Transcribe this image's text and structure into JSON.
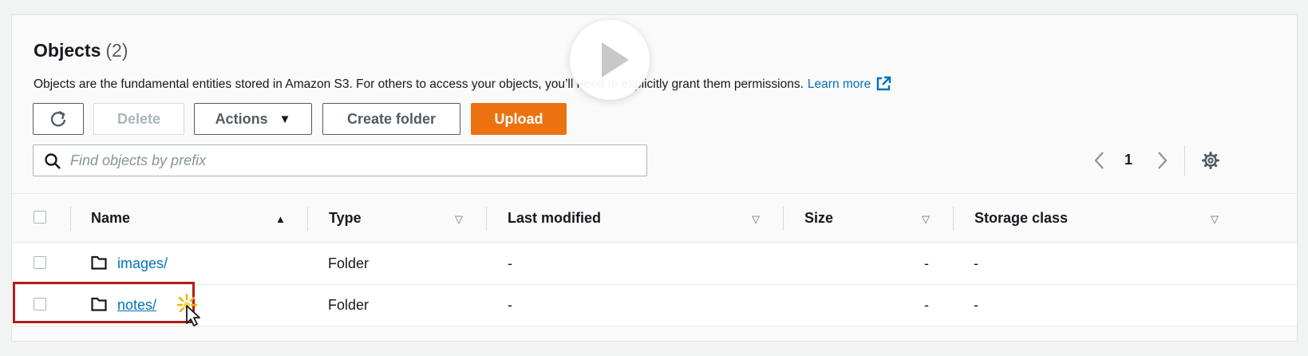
{
  "header": {
    "title": "Objects",
    "count": "(2)",
    "description": "Objects are the fundamental entities stored in Amazon S3. For others to access your objects, you’ll need to explicitly grant them permissions.",
    "learn_more": "Learn more"
  },
  "toolbar": {
    "delete_label": "Delete",
    "actions_label": "Actions",
    "create_folder_label": "Create folder",
    "upload_label": "Upload"
  },
  "search": {
    "placeholder": "Find objects by prefix",
    "value": ""
  },
  "pagination": {
    "current_page": "1"
  },
  "table": {
    "columns": [
      "Name",
      "Type",
      "Last modified",
      "Size",
      "Storage class"
    ],
    "rows": [
      {
        "name": "images/",
        "type": "Folder",
        "last_modified": "-",
        "size": "-",
        "storage_class": "-"
      },
      {
        "name": "notes/",
        "type": "Folder",
        "last_modified": "-",
        "size": "-",
        "storage_class": "-"
      }
    ]
  },
  "colors": {
    "upload_button": "#ec7211",
    "link": "#0073bb",
    "highlight_box": "#b31b1b"
  },
  "icons": [
    "refresh-icon",
    "caret-down-icon",
    "search-icon",
    "chevron-left-icon",
    "chevron-right-icon",
    "gear-icon",
    "folder-icon",
    "external-link-icon",
    "play-icon",
    "cursor-icon"
  ]
}
